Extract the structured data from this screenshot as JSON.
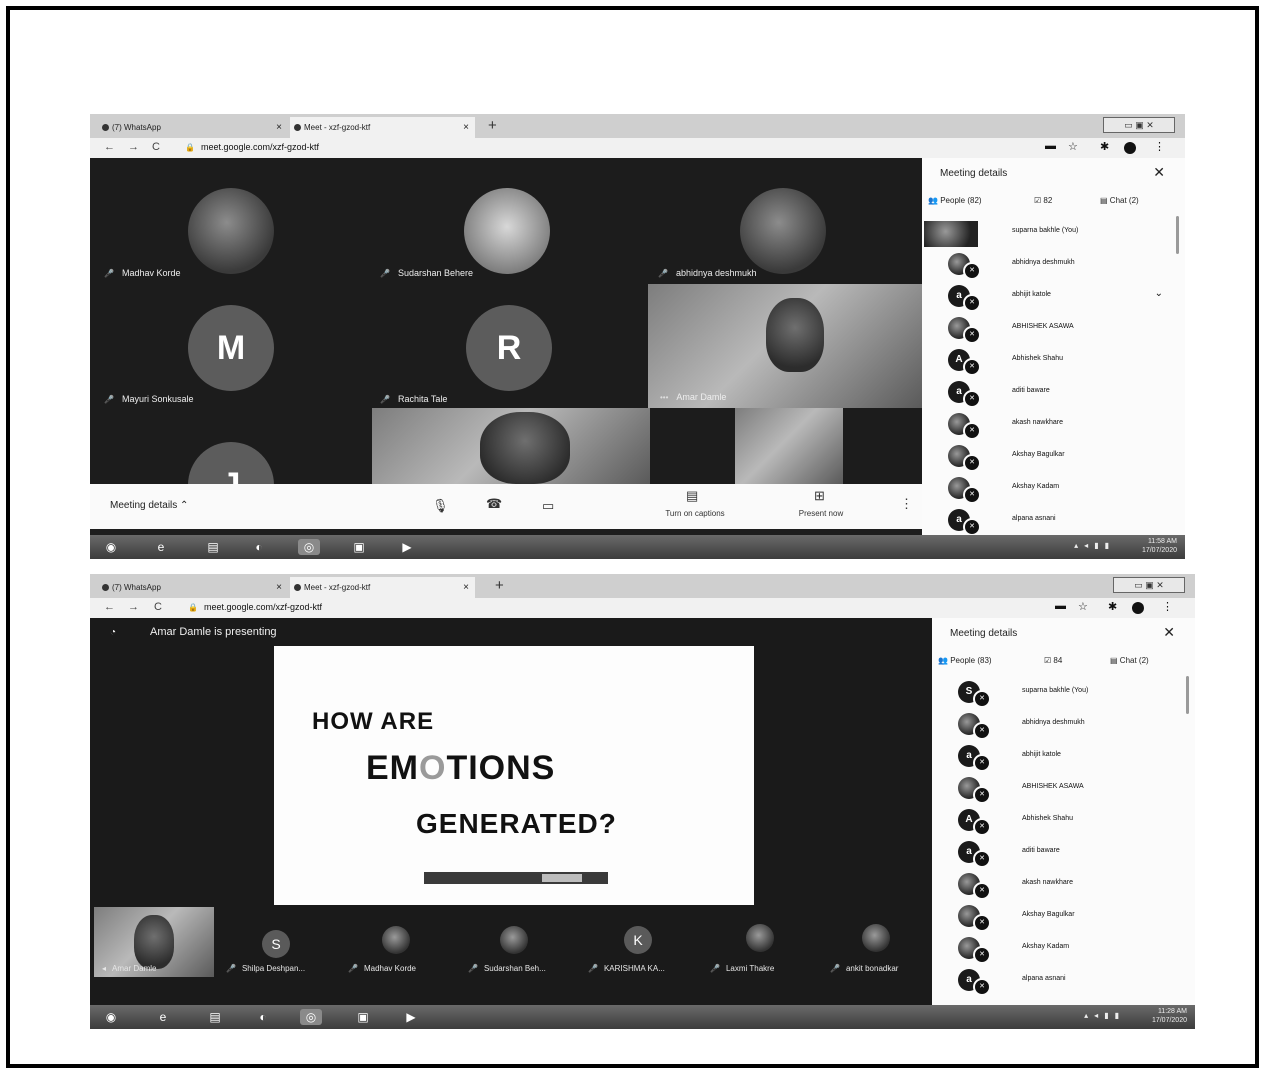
{
  "screenshot1": {
    "tabs": [
      {
        "label": "(7) WhatsApp",
        "close": "×"
      },
      {
        "label": "Meet - xzf-gzod-ktf",
        "close": "×"
      }
    ],
    "new_tab": "+",
    "url": "meet.google.com/xzf-gzod-ktf",
    "tiles": [
      {
        "name": "Madhav Korde"
      },
      {
        "name": "Sudarshan Behere"
      },
      {
        "name": "abhidnya deshmukh"
      },
      {
        "name": "Mayuri Sonkusale",
        "letter": "M"
      },
      {
        "name": "Rachita Tale",
        "letter": "R"
      },
      {
        "name": "Amar Damle"
      },
      {
        "letter": "J"
      }
    ],
    "bottombar": {
      "meeting_details": "Meeting details",
      "captions": "Turn on captions",
      "present": "Present now"
    },
    "panel": {
      "title": "Meeting details",
      "people_tab": "People (82)",
      "tasks_tab": "82",
      "chat_tab": "Chat (2)",
      "people": [
        {
          "name": "suparna bakhle (You)"
        },
        {
          "name": "abhidnya deshmukh"
        },
        {
          "name": "abhijit katole",
          "letter": "a"
        },
        {
          "name": "ABHISHEK ASAWA"
        },
        {
          "name": "Abhishek Shahu",
          "letter": "A"
        },
        {
          "name": "aditi baware",
          "letter": "a"
        },
        {
          "name": "akash nawkhare"
        },
        {
          "name": "Akshay Bagulkar"
        },
        {
          "name": "Akshay Kadam"
        },
        {
          "name": "alpana asnani",
          "letter": "a"
        }
      ]
    },
    "taskbar": {
      "clock_time": "11:58 AM",
      "clock_date": "17/07/2020"
    }
  },
  "screenshot2": {
    "tabs": [
      {
        "label": "(7) WhatsApp",
        "close": "×"
      },
      {
        "label": "Meet - xzf-gzod-ktf",
        "close": "×"
      }
    ],
    "new_tab": "+",
    "url": "meet.google.com/xzf-gzod-ktf",
    "presenting": "Amar Damle is presenting",
    "slide": {
      "line1": "HOW ARE",
      "line2_a": "EM",
      "line2_o": "O",
      "line2_b": "TIONS",
      "line3": "GENERATED?"
    },
    "strip": [
      {
        "name": "Amar Damle"
      },
      {
        "name": "Shilpa Deshpan...",
        "letter": "S"
      },
      {
        "name": "Madhav Korde"
      },
      {
        "name": "Sudarshan Beh..."
      },
      {
        "name": "KARISHMA KA...",
        "letter": "K"
      },
      {
        "name": "Laxmi Thakre"
      },
      {
        "name": "ankit bonadkar"
      }
    ],
    "panel": {
      "title": "Meeting details",
      "people_tab": "People (83)",
      "tasks_tab": "84",
      "chat_tab": "Chat (2)",
      "people": [
        {
          "name": "suparna bakhle (You)",
          "letter": "S"
        },
        {
          "name": "abhidnya deshmukh"
        },
        {
          "name": "abhijit katole",
          "letter": "a"
        },
        {
          "name": "ABHISHEK ASAWA"
        },
        {
          "name": "Abhishek Shahu",
          "letter": "A"
        },
        {
          "name": "aditi baware",
          "letter": "a"
        },
        {
          "name": "akash nawkhare"
        },
        {
          "name": "Akshay Bagulkar"
        },
        {
          "name": "Akshay Kadam"
        },
        {
          "name": "alpana asnani",
          "letter": "a"
        }
      ]
    },
    "taskbar": {
      "clock_time": "11:28 AM",
      "clock_date": "17/07/2020"
    }
  }
}
